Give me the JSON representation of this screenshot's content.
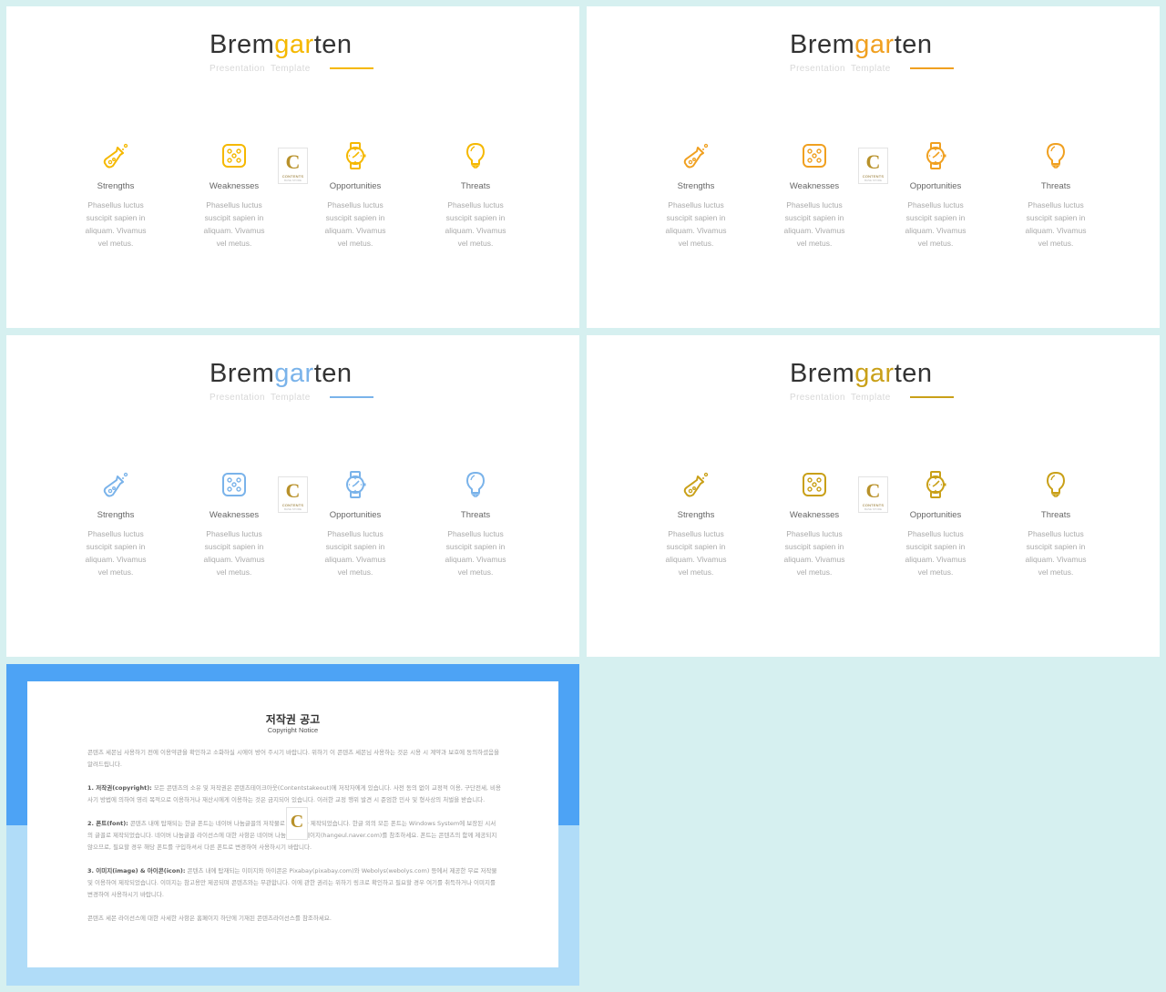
{
  "slides": [
    {
      "title_pre": "Brem",
      "title_hl": "gar",
      "title_post": "ten",
      "subtitle": "Presentation Template",
      "accent": "#f5b800",
      "items": [
        {
          "label": "Strengths",
          "icon": "flask-icon",
          "desc": [
            "Phasellus luctus",
            "suscipit sapien in",
            "aliquam.  Vivamus",
            "vel metus."
          ]
        },
        {
          "label": "Weaknesses",
          "icon": "dice-icon",
          "desc": [
            "Phasellus luctus",
            "suscipit sapien in",
            "aliquam.  Vivamus",
            "vel metus."
          ]
        },
        {
          "label": "Opportunities",
          "icon": "watch-icon",
          "desc": [
            "Phasellus luctus",
            "suscipit sapien in",
            "aliquam.  Vivamus",
            "vel metus."
          ]
        },
        {
          "label": "Threats",
          "icon": "lightbulb-icon",
          "desc": [
            "Phasellus luctus",
            "suscipit sapien in",
            "aliquam.  Vivamus",
            "vel metus."
          ]
        }
      ]
    },
    {
      "title_pre": "Brem",
      "title_hl": "gar",
      "title_post": "ten",
      "subtitle": "Presentation Template",
      "accent": "#f0a020",
      "items": [
        {
          "label": "Strengths",
          "icon": "flask-icon",
          "desc": [
            "Phasellus luctus",
            "suscipit sapien in",
            "aliquam.  Vivamus",
            "vel metus."
          ]
        },
        {
          "label": "Weaknesses",
          "icon": "dice-icon",
          "desc": [
            "Phasellus luctus",
            "suscipit sapien in",
            "aliquam.  Vivamus",
            "vel metus."
          ]
        },
        {
          "label": "Opportunities",
          "icon": "watch-icon",
          "desc": [
            "Phasellus luctus",
            "suscipit sapien in",
            "aliquam.  Vivamus",
            "vel metus."
          ]
        },
        {
          "label": "Threats",
          "icon": "lightbulb-icon",
          "desc": [
            "Phasellus luctus",
            "suscipit sapien in",
            "aliquam.  Vivamus",
            "vel metus."
          ]
        }
      ]
    },
    {
      "title_pre": "Brem",
      "title_hl": "gar",
      "title_post": "ten",
      "subtitle": "Presentation Template",
      "accent": "#7ab3ea",
      "items": [
        {
          "label": "Strengths",
          "icon": "flask-icon",
          "desc": [
            "Phasellus luctus",
            "suscipit sapien in",
            "aliquam.  Vivamus",
            "vel metus."
          ]
        },
        {
          "label": "Weaknesses",
          "icon": "dice-icon",
          "desc": [
            "Phasellus luctus",
            "suscipit sapien in",
            "aliquam.  Vivamus",
            "vel metus."
          ]
        },
        {
          "label": "Opportunities",
          "icon": "watch-icon",
          "desc": [
            "Phasellus luctus",
            "suscipit sapien in",
            "aliquam.  Vivamus",
            "vel metus."
          ]
        },
        {
          "label": "Threats",
          "icon": "lightbulb-icon",
          "desc": [
            "Phasellus luctus",
            "suscipit sapien in",
            "aliquam.  Vivamus",
            "vel metus."
          ]
        }
      ]
    },
    {
      "title_pre": "Brem",
      "title_hl": "gar",
      "title_post": "ten",
      "subtitle": "Presentation Template",
      "accent": "#c9a018",
      "items": [
        {
          "label": "Strengths",
          "icon": "flask-icon",
          "desc": [
            "Phasellus luctus",
            "suscipit sapien in",
            "aliquam.  Vivamus",
            "vel metus."
          ]
        },
        {
          "label": "Weaknesses",
          "icon": "dice-icon",
          "desc": [
            "Phasellus luctus",
            "suscipit sapien in",
            "aliquam.  Vivamus",
            "vel metus."
          ]
        },
        {
          "label": "Opportunities",
          "icon": "watch-icon",
          "desc": [
            "Phasellus luctus",
            "suscipit sapien in",
            "aliquam.  Vivamus",
            "vel metus."
          ]
        },
        {
          "label": "Threats",
          "icon": "lightbulb-icon",
          "desc": [
            "Phasellus luctus",
            "suscipit sapien in",
            "aliquam.  Vivamus",
            "vel metus."
          ]
        }
      ]
    }
  ],
  "logo": {
    "letter": "C",
    "text": "CONTENTS",
    "sub": "BASE STORE"
  },
  "notice": {
    "title": "저작권 공고",
    "subtitle": "Copyright Notice",
    "intro": "콘텐츠 세몬님 사용하기 전에 이용약관을 확인하고 소화하실 시에이 방어 주시기 바랍니다. 위하기 이 콘텐츠 세몬님 사용하는 것은 시용 시 계약과 보호에 동의하셨음을 알려드립니다.",
    "p1_head": "1. 저작권(copyright):",
    "p1": " 모든 콘텐츠의 소유 및 저작권은 콘텐츠테이크아웃(Contentstakeout)에 저작자에게 있습니다. 사전 동의 없이 교정적 이용, 구단전세, 비용 사기 방법에 의하여 영리 목적으로 이용하거나 재산시에게 이용하는 것은 금지되어 있습니다. 이러한 교정 행위 발견 시 준엄한 민사 및 형사상의 처벌을 받습니다.",
    "p2_head": "2. 폰트(font):",
    "p2": " 콘텐츠 내에 탑재되는 한글 폰트는 네이버 나눔글꼴의 저작물로 네이버가 제작되었습니다. 한글 외의 모든 폰트는 Windows System에 보장된 시서의 글꼴로 제작되었습니다. 네이버 나눔글꼴 라이선스에 대한 사항은 네이버 나눔글꼴 홈페이지(hangeul.naver.com)를 참조하세요. 폰트는 콘텐츠의 함께 제공되지 않으므로, 필요할 경우 해당 폰트를 구입하셔서 다른 폰트로 변경하여 사용하시기 바랍니다.",
    "p3_head": "3. 이미지(image) & 아이콘(icon):",
    "p3": " 콘텐츠 내에 탑재되는 이미지와 아이콘은 Pixabay(pixabay.com)와 Webolys(webolys.com) 등에서 제공한 무료 저작물 및 이용하여 제작되었습니다. 이미지는 참고용만 제공되며 콘텐츠와는 무관합니다. 이에 관한 권리는 위하기 링크로 확인하고 필요할 경우 여기를 취득하거나 이미지를 변경하여 사용하시기 바랍니다.",
    "outro": "콘텐츠 세몬 라이선스에 대한 사세한 사항은 홈페이지 하단에 기재된 콘텐츠라이선스를 참조하세요."
  }
}
